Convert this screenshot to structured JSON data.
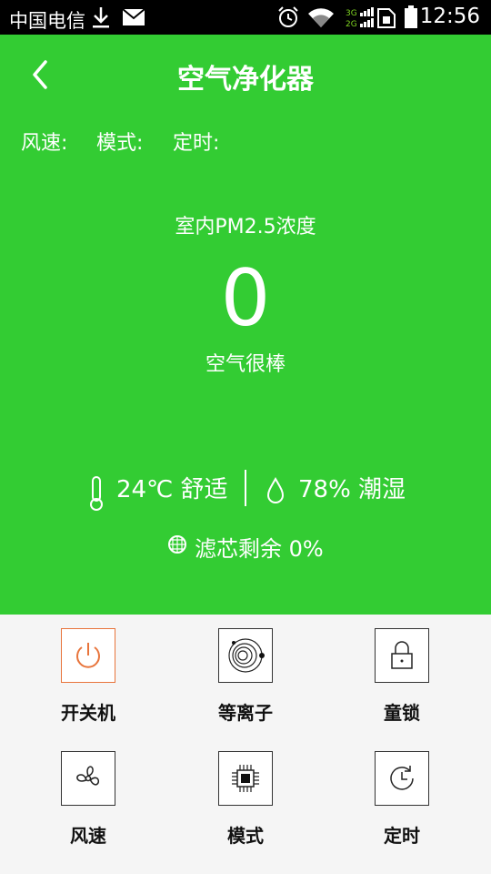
{
  "status_bar": {
    "carrier": "中国电信",
    "time": "12:56"
  },
  "header": {
    "title": "空气净化器"
  },
  "info": {
    "wind_label": "风速:",
    "mode_label": "模式:",
    "timer_label": "定时:"
  },
  "pm": {
    "label": "室内PM2.5浓度",
    "value": "0",
    "quality": "空气很棒"
  },
  "env": {
    "temperature": "24℃ 舒适",
    "humidity": "78% 潮湿"
  },
  "filter": {
    "text": "滤芯剩余 0%"
  },
  "controls": [
    {
      "label": "开关机",
      "icon": "power-icon",
      "active": true
    },
    {
      "label": "等离子",
      "icon": "plasma-icon",
      "active": false
    },
    {
      "label": "童锁",
      "icon": "lock-icon",
      "active": false
    },
    {
      "label": "风速",
      "icon": "fan-icon",
      "active": false
    },
    {
      "label": "模式",
      "icon": "chip-icon",
      "active": false
    },
    {
      "label": "定时",
      "icon": "clock-icon",
      "active": false
    }
  ],
  "colors": {
    "primary_green": "#33cc33",
    "power_accent": "#e8743b",
    "panel_bg": "#f5f5f5"
  }
}
